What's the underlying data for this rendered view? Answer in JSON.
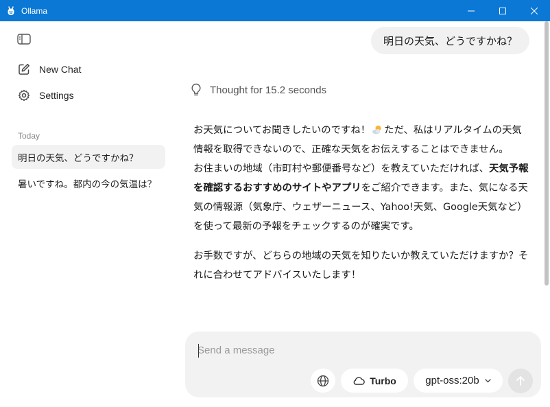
{
  "window": {
    "title": "Ollama",
    "controls": [
      "minimize-icon",
      "maximize-icon",
      "close-icon"
    ],
    "accent": "#0a78d4"
  },
  "sidebar": {
    "toggle_icon": "sidebar-toggle-icon",
    "items": [
      {
        "label": "New Chat",
        "icon": "compose-icon"
      },
      {
        "label": "Settings",
        "icon": "gear-icon"
      }
    ],
    "section_label": "Today",
    "chats": [
      {
        "label": "明日の天気、どうですかね？",
        "active": true
      },
      {
        "label": "暑いですね。都内の今の気温は？",
        "active": false
      }
    ]
  },
  "conversation": {
    "user_message": "明日の天気、どうですかね？",
    "thought_label": "Thought for 15.2 seconds",
    "answer": {
      "p1_a": "お天気についてお聞きしたいのですね！",
      "p1_b": "ただ、私はリアルタイムの天気情報を取得できないので、正確な天気をお伝えすることはできません。",
      "p1_c": "お住まいの地域（市町村や郵便番号など）を教えていただければ、",
      "p1_bold": "天気予報を確認するおすすめのサイトやアプリ",
      "p1_d": "をご紹介できます。また、気になる天気の情報源（気象庁、ウェザーニュース、Yahoo!天気、Google天気など）を使って最新の予報をチェックするのが確実です。",
      "p2": "お手数ですが、どちらの地域の天気を知りたいか教えていただけますか？それに合わせてアドバイスいたします！"
    }
  },
  "composer": {
    "placeholder": "Send a message",
    "value": "",
    "web_search_icon": "globe-icon",
    "turbo_label": "Turbo",
    "model_label": "gpt-oss:20b",
    "send_icon": "arrow-up-icon"
  }
}
